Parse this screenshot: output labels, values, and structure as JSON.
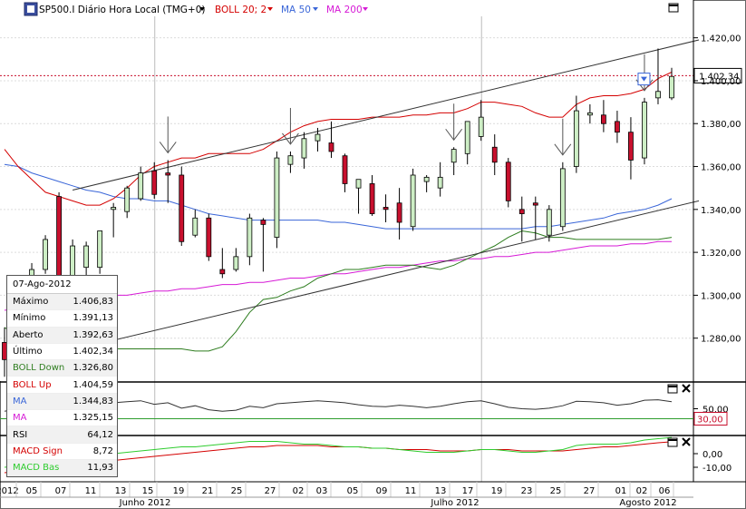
{
  "header": {
    "symbol_icon": "chart-app-icon",
    "title": "SP500.I Diário Hora Local (TMG+0)",
    "indicators": [
      {
        "label": "BOLL 20; 2",
        "color": "#d40000"
      },
      {
        "label": "MA 50",
        "color": "#3a66d8"
      },
      {
        "label": "MA 200",
        "color": "#d61ad6"
      }
    ]
  },
  "info": {
    "date": "07-Ago-2012",
    "rows": [
      {
        "label": "Máximo",
        "value": "1.406,83",
        "color": "#000000"
      },
      {
        "label": "Mínimo",
        "value": "1.391,13",
        "color": "#000000"
      },
      {
        "label": "Aberto",
        "value": "1.392,63",
        "color": "#000000"
      },
      {
        "label": "Último",
        "value": "1.402,34",
        "color": "#000000"
      },
      {
        "label": "BOLL Down",
        "value": "1.326,80",
        "color": "#2e7d1f"
      },
      {
        "label": "BOLL Up",
        "value": "1.404,59",
        "color": "#d40000"
      },
      {
        "label": "MA",
        "value": "1.344,83",
        "color": "#3a66d8"
      },
      {
        "label": "MA",
        "value": "1.325,15",
        "color": "#d61ad6"
      },
      {
        "label": "RSI",
        "value": "64,12",
        "color": "#000000"
      },
      {
        "label": "MACD Sign",
        "value": "8,72",
        "color": "#d40000"
      },
      {
        "label": "MACD Bas",
        "value": "11,93",
        "color": "#2ecc2e"
      }
    ]
  },
  "chart_data": {
    "type": "candlestick",
    "x_tick_labels": [
      "2012",
      "05",
      "07",
      "11",
      "13",
      "15",
      "19",
      "21",
      "25",
      "27",
      "02",
      "03",
      "05",
      "09",
      "11",
      "13",
      "17",
      "19",
      "23",
      "25",
      "27",
      "01",
      "02",
      "06"
    ],
    "month_labels": [
      "Junho 2012",
      "Julho 2012",
      "Agosto 2012"
    ],
    "y_range": [
      1260,
      1430
    ],
    "y_tick_labels": [
      "1.420,00",
      "1.400,00",
      "1.380,00",
      "1.360,00",
      "1.340,00",
      "1.320,00",
      "1.300,00",
      "1.280,00"
    ],
    "y_ticks": [
      1420,
      1400,
      1380,
      1360,
      1340,
      1320,
      1300,
      1280
    ],
    "last_price": 1402.34,
    "last_price_label": "1.402,34",
    "candles": [
      {
        "o": 1278,
        "h": 1285,
        "l": 1262,
        "c": 1270
      },
      {
        "o": 1285,
        "h": 1307,
        "l": 1282,
        "c": 1304
      },
      {
        "o": 1303,
        "h": 1315,
        "l": 1296,
        "c": 1312
      },
      {
        "o": 1312,
        "h": 1328,
        "l": 1310,
        "c": 1326
      },
      {
        "o": 1346,
        "h": 1348,
        "l": 1302,
        "c": 1305
      },
      {
        "o": 1305,
        "h": 1326,
        "l": 1303,
        "c": 1323
      },
      {
        "o": 1313,
        "h": 1325,
        "l": 1307,
        "c": 1323
      },
      {
        "o": 1313,
        "h": 1328,
        "l": 1310,
        "c": 1330
      },
      {
        "o": 1340,
        "h": 1343,
        "l": 1327,
        "c": 1341
      },
      {
        "o": 1339,
        "h": 1351,
        "l": 1336,
        "c": 1350
      },
      {
        "o": 1345,
        "h": 1360,
        "l": 1344,
        "c": 1357
      },
      {
        "o": 1358,
        "h": 1362,
        "l": 1345,
        "c": 1347
      },
      {
        "o": 1357,
        "h": 1363,
        "l": 1343,
        "c": 1356
      },
      {
        "o": 1356,
        "h": 1360,
        "l": 1323,
        "c": 1325
      },
      {
        "o": 1328,
        "h": 1340,
        "l": 1327,
        "c": 1336
      },
      {
        "o": 1336,
        "h": 1338,
        "l": 1316,
        "c": 1318
      },
      {
        "o": 1312,
        "h": 1322,
        "l": 1308,
        "c": 1310
      },
      {
        "o": 1312,
        "h": 1322,
        "l": 1311,
        "c": 1318
      },
      {
        "o": 1318,
        "h": 1338,
        "l": 1314,
        "c": 1336
      },
      {
        "o": 1335,
        "h": 1336,
        "l": 1311,
        "c": 1333
      },
      {
        "o": 1327,
        "h": 1367,
        "l": 1322,
        "c": 1364
      },
      {
        "o": 1361,
        "h": 1367,
        "l": 1357,
        "c": 1365
      },
      {
        "o": 1364,
        "h": 1376,
        "l": 1359,
        "c": 1373
      },
      {
        "o": 1372,
        "h": 1378,
        "l": 1367,
        "c": 1375
      },
      {
        "o": 1371,
        "h": 1381,
        "l": 1364,
        "c": 1367
      },
      {
        "o": 1365,
        "h": 1366,
        "l": 1348,
        "c": 1352
      },
      {
        "o": 1350,
        "h": 1352,
        "l": 1338,
        "c": 1354
      },
      {
        "o": 1352,
        "h": 1356,
        "l": 1337,
        "c": 1338
      },
      {
        "o": 1341,
        "h": 1347,
        "l": 1334,
        "c": 1340
      },
      {
        "o": 1343,
        "h": 1350,
        "l": 1326,
        "c": 1334
      },
      {
        "o": 1332,
        "h": 1359,
        "l": 1330,
        "c": 1356
      },
      {
        "o": 1353,
        "h": 1356,
        "l": 1348,
        "c": 1355
      },
      {
        "o": 1350,
        "h": 1362,
        "l": 1346,
        "c": 1355
      },
      {
        "o": 1362,
        "h": 1369,
        "l": 1356,
        "c": 1368
      },
      {
        "o": 1366,
        "h": 1379,
        "l": 1361,
        "c": 1381
      },
      {
        "o": 1374,
        "h": 1391,
        "l": 1372,
        "c": 1383
      },
      {
        "o": 1369,
        "h": 1375,
        "l": 1356,
        "c": 1362
      },
      {
        "o": 1362,
        "h": 1364,
        "l": 1341,
        "c": 1344
      },
      {
        "o": 1340,
        "h": 1346,
        "l": 1325,
        "c": 1338
      },
      {
        "o": 1343,
        "h": 1346,
        "l": 1326,
        "c": 1342
      },
      {
        "o": 1328,
        "h": 1342,
        "l": 1325,
        "c": 1340
      },
      {
        "o": 1332,
        "h": 1362,
        "l": 1330,
        "c": 1359
      },
      {
        "o": 1360,
        "h": 1393,
        "l": 1357,
        "c": 1386
      },
      {
        "o": 1384,
        "h": 1389,
        "l": 1380,
        "c": 1385
      },
      {
        "o": 1384,
        "h": 1391,
        "l": 1376,
        "c": 1380
      },
      {
        "o": 1381,
        "h": 1386,
        "l": 1371,
        "c": 1376
      },
      {
        "o": 1376,
        "h": 1383,
        "l": 1354,
        "c": 1363
      },
      {
        "o": 1364,
        "h": 1392,
        "l": 1361,
        "c": 1390
      },
      {
        "o": 1392,
        "h": 1415,
        "l": 1389,
        "c": 1395
      },
      {
        "o": 1392,
        "h": 1406,
        "l": 1391,
        "c": 1402
      }
    ],
    "boll_up": [
      1368,
      1360,
      1354,
      1348,
      1346,
      1344,
      1342,
      1342,
      1345,
      1350,
      1356,
      1360,
      1362,
      1364,
      1364,
      1366,
      1366,
      1366,
      1366,
      1368,
      1372,
      1376,
      1379,
      1381,
      1382,
      1382,
      1382,
      1383,
      1383,
      1383,
      1384,
      1384,
      1385,
      1385,
      1387,
      1390,
      1390,
      1389,
      1388,
      1385,
      1383,
      1383,
      1389,
      1392,
      1393,
      1393,
      1394,
      1396,
      1401,
      1404
    ],
    "boll_down": [
      1285,
      1281,
      1278,
      1277,
      1278,
      1276,
      1275,
      1275,
      1275,
      1275,
      1275,
      1275,
      1275,
      1275,
      1274,
      1274,
      1276,
      1283,
      1292,
      1298,
      1299,
      1302,
      1304,
      1308,
      1310,
      1312,
      1312,
      1313,
      1314,
      1314,
      1314,
      1313,
      1312,
      1314,
      1317,
      1320,
      1323,
      1327,
      1330,
      1329,
      1327,
      1327,
      1326,
      1326,
      1326,
      1326,
      1326,
      1326,
      1326,
      1327
    ],
    "ma50": [
      1361,
      1360,
      1357,
      1355,
      1353,
      1351,
      1349,
      1348,
      1346,
      1345,
      1345,
      1344,
      1344,
      1342,
      1340,
      1338,
      1337,
      1336,
      1335,
      1335,
      1335,
      1335,
      1335,
      1335,
      1334,
      1334,
      1333,
      1332,
      1331,
      1331,
      1331,
      1331,
      1331,
      1331,
      1331,
      1331,
      1331,
      1331,
      1331,
      1332,
      1332,
      1333,
      1334,
      1335,
      1336,
      1338,
      1339,
      1340,
      1342,
      1345
    ],
    "ma200": [
      1293,
      1294,
      1295,
      1296,
      1297,
      1297,
      1298,
      1299,
      1300,
      1300,
      1301,
      1302,
      1302,
      1303,
      1303,
      1304,
      1305,
      1305,
      1306,
      1306,
      1307,
      1308,
      1308,
      1309,
      1310,
      1310,
      1311,
      1312,
      1313,
      1313,
      1314,
      1315,
      1316,
      1316,
      1317,
      1317,
      1318,
      1318,
      1319,
      1320,
      1320,
      1321,
      1322,
      1323,
      1323,
      1323,
      1324,
      1324,
      1325,
      1325
    ],
    "trendlines": [
      {
        "from": {
          "i": 5,
          "y": 1349
        },
        "to": {
          "i": 51,
          "y": 1419
        }
      },
      {
        "from": {
          "i": 8,
          "y": 1279
        },
        "to": {
          "i": 51,
          "y": 1344
        }
      }
    ],
    "arrows": [
      12,
      21,
      33,
      41,
      47
    ],
    "rsi": {
      "y_tick_labels": [
        "50,00"
      ],
      "reference": 30,
      "reference_label": "30,00",
      "values": [
        45,
        50,
        52,
        60,
        49,
        54,
        56,
        58,
        62,
        64,
        66,
        59,
        62,
        51,
        56,
        48,
        45,
        47,
        55,
        52,
        60,
        62,
        64,
        66,
        64,
        62,
        58,
        55,
        54,
        57,
        55,
        52,
        55,
        60,
        64,
        66,
        60,
        53,
        50,
        49,
        51,
        56,
        65,
        64,
        62,
        57,
        60,
        67,
        68,
        64
      ]
    },
    "macd": {
      "y_tick_labels": [
        "0,00",
        "-10,00"
      ],
      "signal_color": "#d40000",
      "base_color": "#2ecc2e",
      "signal": [
        -14,
        -13,
        -12,
        -11,
        -10,
        -9,
        -8,
        -6,
        -5,
        -4,
        -3,
        -2,
        -1,
        0,
        1,
        2,
        3,
        4,
        5,
        5,
        6,
        6,
        6,
        6,
        5,
        5,
        5,
        4,
        4,
        3,
        3,
        3,
        2,
        2,
        2,
        3,
        3,
        3,
        2,
        2,
        2,
        2,
        3,
        4,
        5,
        5,
        6,
        7,
        8,
        8.72
      ],
      "base": [
        -10,
        -9,
        -8,
        -6,
        -5,
        -3,
        -2,
        -1,
        0,
        1,
        2,
        3,
        4,
        5,
        5,
        6,
        7,
        8,
        9,
        9,
        9,
        8,
        7,
        7,
        6,
        5,
        5,
        4,
        4,
        3,
        2,
        1,
        1,
        1,
        2,
        3,
        3,
        2,
        1,
        1,
        2,
        3,
        6,
        7,
        7,
        7,
        8,
        10,
        11,
        11.93
      ]
    }
  }
}
